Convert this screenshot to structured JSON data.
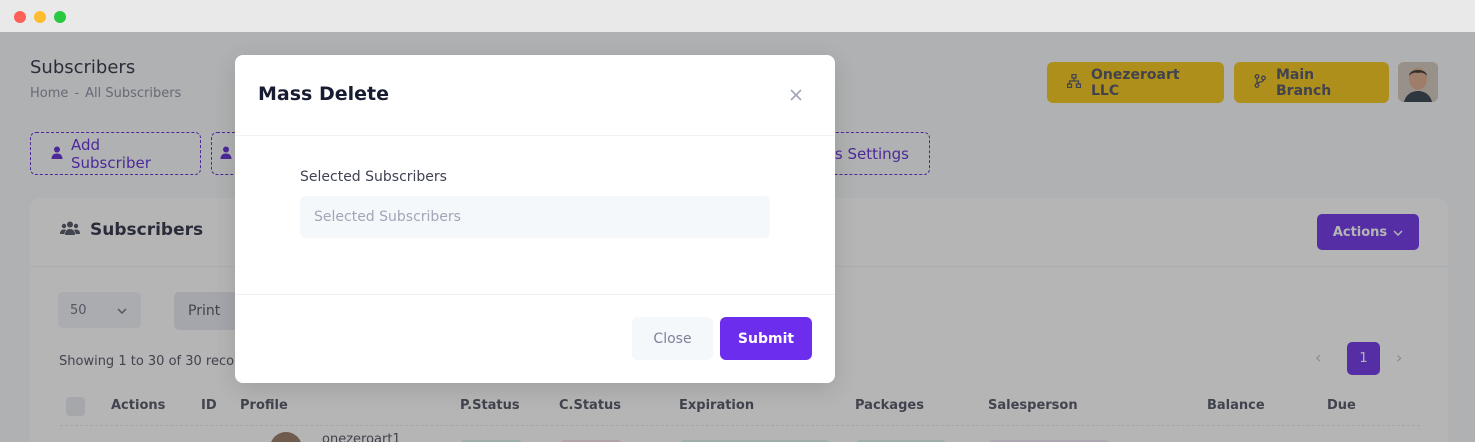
{
  "header": {
    "page_title": "Subscribers",
    "breadcrumb": [
      "Home",
      "-",
      "All Subscribers"
    ],
    "org_button": "Onezeroart LLC",
    "branch_button": "Main Branch"
  },
  "toolbar": {
    "add_subscriber": "Add Subscriber",
    "mass_settings_partial": "ss Settings"
  },
  "card": {
    "title": "Subscribers",
    "actions_label": "Actions",
    "page_size": "50",
    "print_label": "Print",
    "showing_text": "Showing 1 to 30 of 30 recor",
    "current_page": "1",
    "columns": [
      "Actions",
      "ID",
      "Profile",
      "P.Status",
      "C.Status",
      "Expiration",
      "Packages",
      "Salesperson",
      "Balance",
      "Due"
    ],
    "first_row_name_partial": "onezeroart1"
  },
  "modal": {
    "title": "Mass Delete",
    "field_label": "Selected Subscribers",
    "field_placeholder": "Selected Subscribers",
    "field_value": "",
    "close_label": "Close",
    "submit_label": "Submit"
  },
  "colors": {
    "primary": "#6c2ded",
    "warning": "#f6c000",
    "overlay": "rgba(70,70,70,0.40)"
  }
}
